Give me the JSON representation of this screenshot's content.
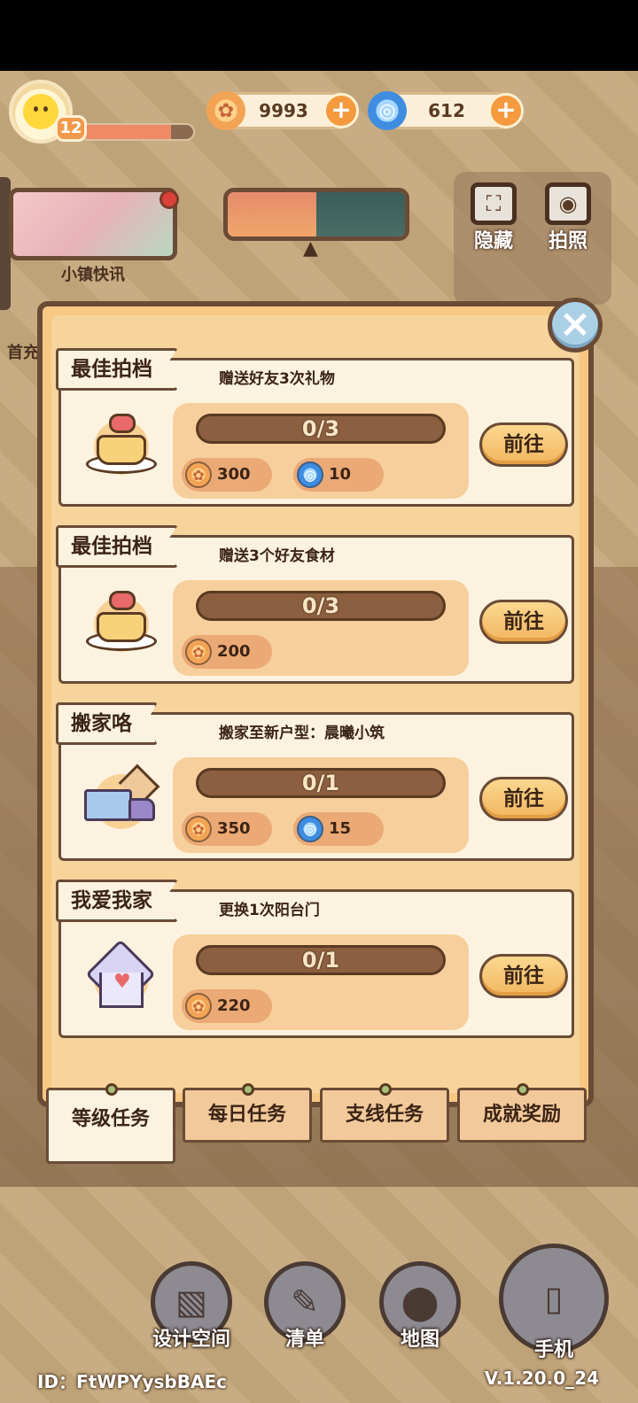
{
  "player": {
    "level": "12",
    "xp_fraction": 0.8
  },
  "currency": {
    "gold": "9993",
    "gems": "612",
    "gold_icon": "gold-coin-icon",
    "gem_icon": "blue-swirl-gem-icon",
    "plus_label": "+"
  },
  "town_news": {
    "label": "小镇快讯"
  },
  "side_buttons": [
    {
      "label": "隐藏",
      "icon": "hide-frame-icon"
    },
    {
      "label": "拍照",
      "icon": "camera-icon"
    }
  ],
  "left_edge": {
    "label": "首充"
  },
  "modal": {
    "close_label": "×",
    "tasks": [
      {
        "tag": "最佳拍档",
        "desc": "赠送好友3次礼物",
        "progress": "0/3",
        "progress_fraction": 0,
        "rewards": [
          {
            "type": "gold",
            "amount": "300"
          },
          {
            "type": "gem",
            "amount": "10"
          }
        ],
        "button": "前往",
        "icon": "cake-icon"
      },
      {
        "tag": "最佳拍档",
        "desc": "赠送3个好友食材",
        "progress": "0/3",
        "progress_fraction": 0,
        "rewards": [
          {
            "type": "gold",
            "amount": "200"
          }
        ],
        "button": "前往",
        "icon": "cake-icon"
      },
      {
        "tag": "搬家咯",
        "desc": "搬家至新户型：晨曦小筑",
        "progress": "0/1",
        "progress_fraction": 0,
        "rewards": [
          {
            "type": "gold",
            "amount": "350"
          },
          {
            "type": "gem",
            "amount": "15"
          }
        ],
        "button": "前往",
        "icon": "moving-truck-icon"
      },
      {
        "tag": "我爱我家",
        "desc": "更换1次阳台门",
        "progress": "0/1",
        "progress_fraction": 0,
        "rewards": [
          {
            "type": "gold",
            "amount": "220"
          }
        ],
        "button": "前往",
        "icon": "heart-house-icon"
      }
    ],
    "tabs": [
      "等级任务",
      "每日任务",
      "支线任务",
      "成就奖励"
    ]
  },
  "bottom_nav": [
    {
      "label": "设计空间",
      "icon": "design-space-icon"
    },
    {
      "label": "清单",
      "icon": "list-icon"
    },
    {
      "label": "地图",
      "icon": "map-pin-icon"
    },
    {
      "label": "手机",
      "icon": "phone-icon"
    }
  ],
  "footer": {
    "id": "ID：FtWPYysbBAEc",
    "version": "V.1.20.0_24"
  }
}
